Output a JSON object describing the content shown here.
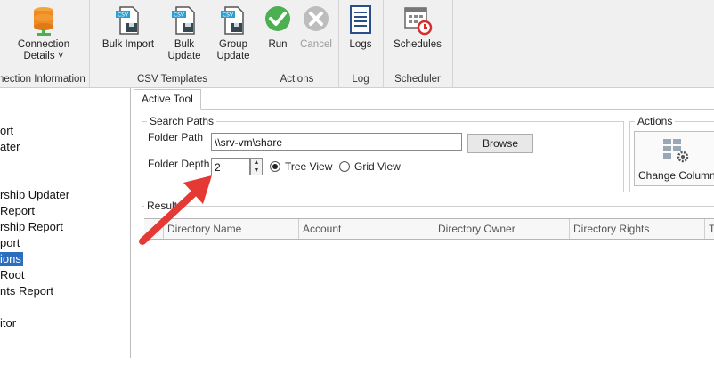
{
  "ribbon": {
    "connection": {
      "label_line1": "Connection",
      "label_line2": "Details",
      "chevron": "˅",
      "group_label": "nection Information"
    },
    "csv": {
      "bulk_import": "Bulk Import",
      "bulk_update": "Bulk Update",
      "group_update_line1": "Group",
      "group_update_line2": "Update",
      "group_label": "CSV Templates",
      "badge": "CSV"
    },
    "actions": {
      "run": "Run",
      "cancel": "Cancel",
      "group_label": "Actions"
    },
    "log": {
      "logs": "Logs",
      "group_label": "Log"
    },
    "scheduler": {
      "schedules": "Schedules",
      "group_label": "Scheduler"
    }
  },
  "left_panel": {
    "items": [
      "ort",
      "ater",
      "rship Updater",
      "Report",
      "rship Report",
      "port",
      "ions",
      "Root",
      "nts Report",
      "itor"
    ],
    "selected_index": 6
  },
  "tabs": {
    "active": "Active Tool"
  },
  "search_paths": {
    "legend": "Search Paths",
    "folder_path_label": "Folder Path",
    "folder_path_value": "\\\\srv-vm\\share",
    "browse": "Browse",
    "folder_depth_label": "Folder Depth",
    "folder_depth_value": "2",
    "tree_view": "Tree View",
    "grid_view": "Grid View",
    "selected_view": "Tree View"
  },
  "actions_panel": {
    "legend": "Actions",
    "change_columns": "Change Columns"
  },
  "results": {
    "legend": "Results",
    "columns": [
      "Directory Name",
      "Account",
      "Directory Owner",
      "Directory Rights",
      "T"
    ]
  },
  "colors": {
    "accent": "#2c6ebe",
    "arrow": "#e53935",
    "run_green": "#4caf50"
  }
}
